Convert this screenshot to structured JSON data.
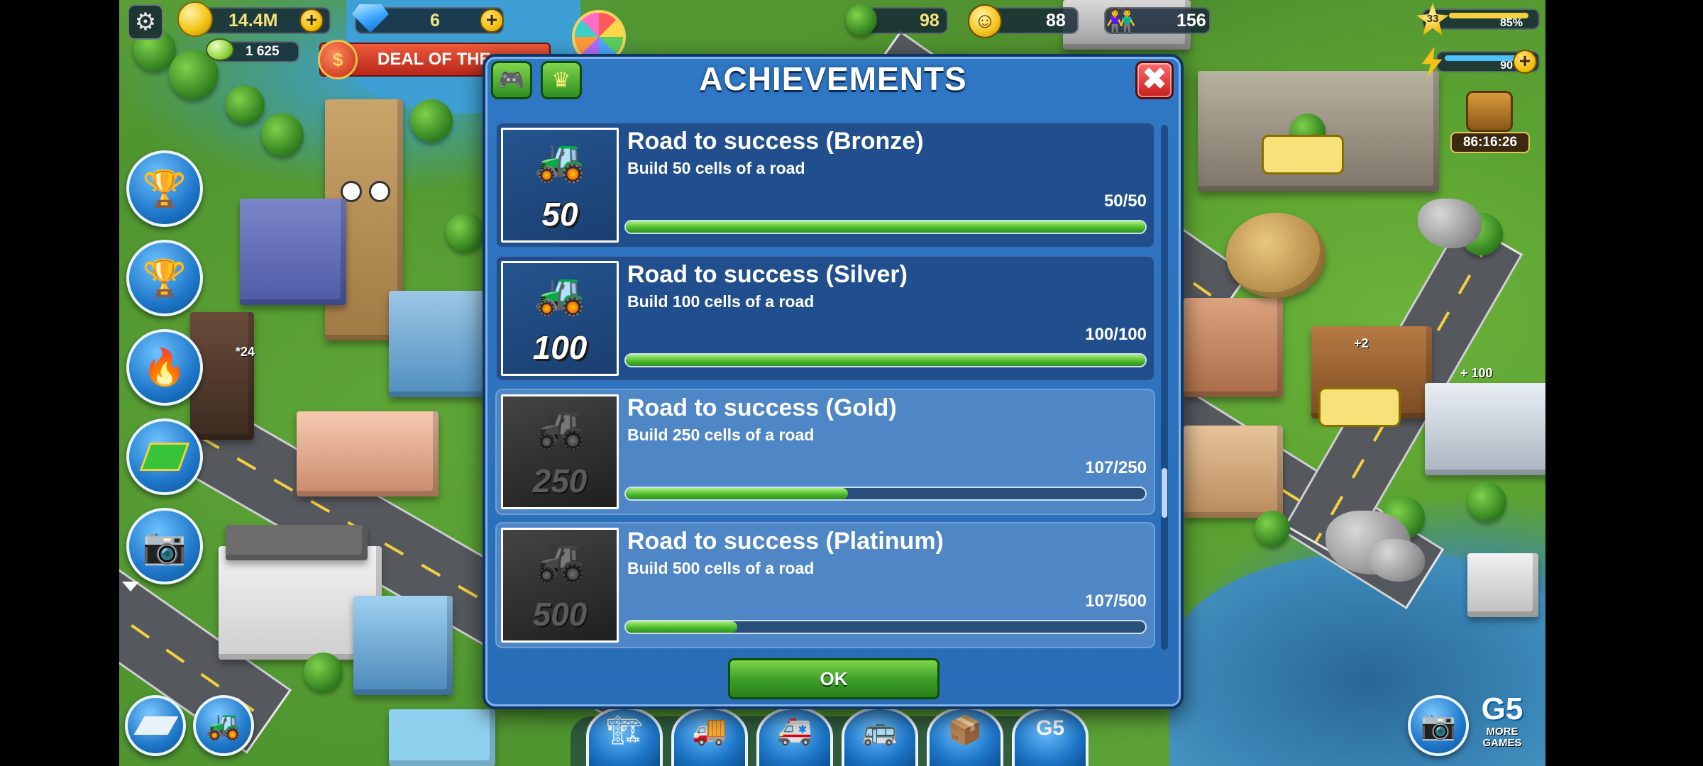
{
  "hud": {
    "coins": "14.4M",
    "gems": "6",
    "bonus": "1 625",
    "deal_banner": "DEAL OF THE",
    "trees": "98",
    "happiness": "88",
    "population": "156",
    "level": "33",
    "level_progress_pct": "85%",
    "energy": "90",
    "timer": "86:16:26",
    "ramp_badge": "24",
    "floating_plus2": "+2",
    "floating_plus100": "+ 100",
    "more_games": "MORE\nGAMES"
  },
  "dialog": {
    "title": "ACHIEVEMENTS",
    "ok_label": "OK",
    "close_label": "✖",
    "achievements": [
      {
        "title": "Road to success (Bronze)",
        "desc": "Build 50 cells of a road",
        "count": "50/50",
        "badge": "50",
        "progress": 1.0,
        "status": "done"
      },
      {
        "title": "Road to success (Silver)",
        "desc": "Build 100 cells of a road",
        "count": "100/100",
        "badge": "100",
        "progress": 1.0,
        "status": "done"
      },
      {
        "title": "Road to success (Gold)",
        "desc": "Build 250 cells of a road",
        "count": "107/250",
        "badge": "250",
        "progress": 0.428,
        "status": "open"
      },
      {
        "title": "Road to success (Platinum)",
        "desc": "Build 500 cells of a road",
        "count": "107/500",
        "badge": "500",
        "progress": 0.214,
        "status": "open"
      }
    ]
  },
  "colors": {
    "dialog_blue": "#2f78c6",
    "progress_green": "#49b72b",
    "ok_green": "#3a9d25",
    "close_red": "#c61e1e"
  }
}
